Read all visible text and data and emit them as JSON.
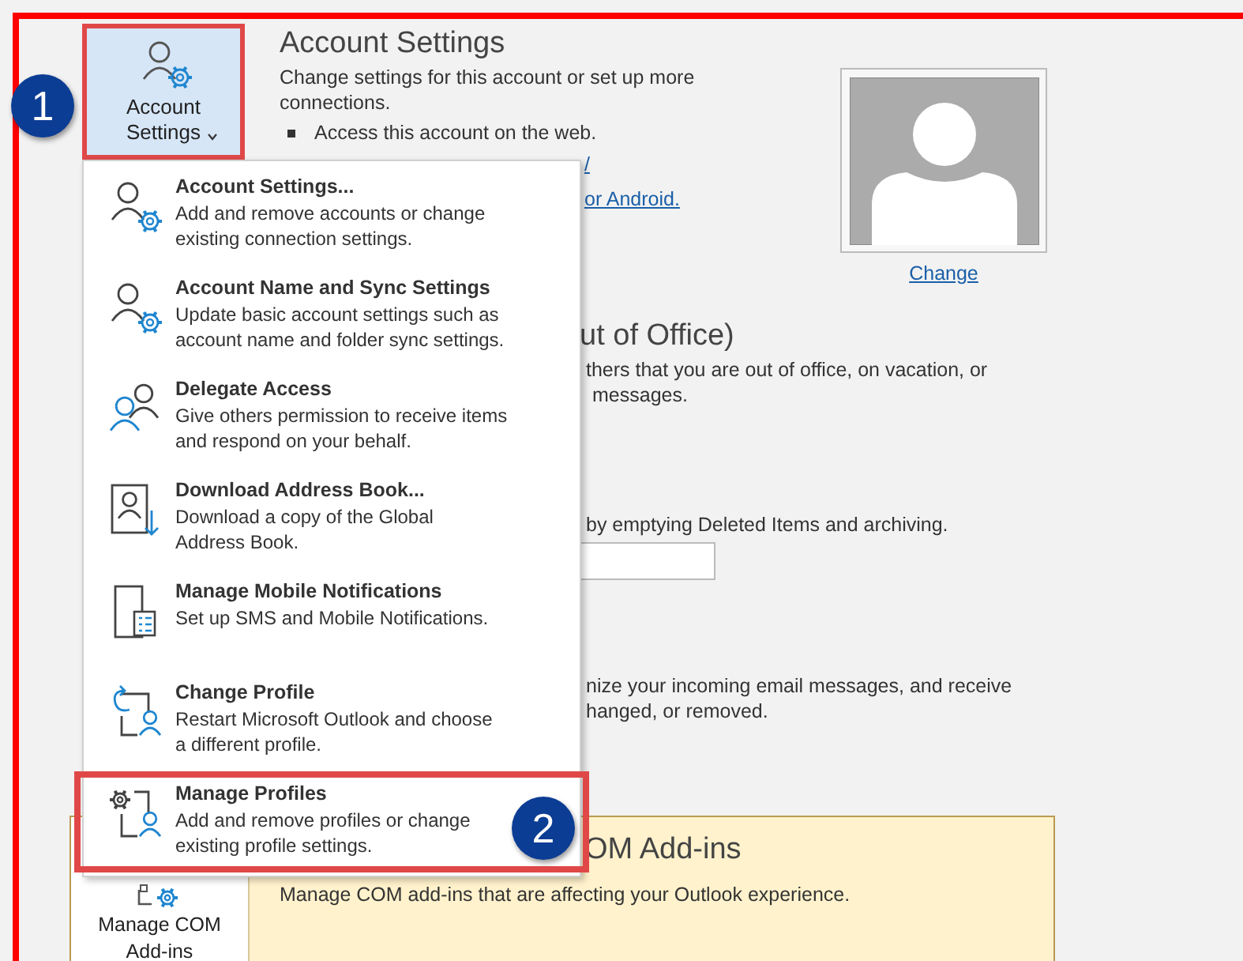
{
  "account_section": {
    "button": {
      "label": "Account Settings",
      "expanded": true,
      "highlighted": true
    },
    "title": "Account Settings",
    "description": "Change settings for this account or set up more connections.",
    "bullets": [
      "Access this account on the web."
    ],
    "links": [
      "/",
      "or Android."
    ],
    "photo_link": "Change"
  },
  "automatic_replies": {
    "title": "ut of Office)",
    "lines": [
      "thers that you are out of office, on vacation, or",
      "messages."
    ]
  },
  "mailbox_settings": {
    "lines": [
      "by emptying Deleted Items and archiving."
    ]
  },
  "rules": {
    "lines": [
      "nize your incoming email messages, and receive",
      "hanged, or removed."
    ]
  },
  "com_addins": {
    "button": "Manage COM Add-ins",
    "title": "OM Add-ins",
    "description": "Manage COM add-ins that are affecting your Outlook experience."
  },
  "menu": {
    "items": [
      {
        "kind": "account-gear",
        "title": "Account Settings...",
        "description": [
          "Add and remove accounts or change",
          "existing connection settings."
        ],
        "highlighted": false
      },
      {
        "kind": "account-gear",
        "title": "Account Name and Sync Settings",
        "description": [
          "Update basic account settings such as",
          "account name and folder sync settings."
        ],
        "highlighted": false
      },
      {
        "kind": "people",
        "title": "Delegate Access",
        "description": [
          "Give others permission to receive items",
          "and respond on your behalf."
        ],
        "highlighted": false
      },
      {
        "kind": "address-book",
        "title": "Download Address Book...",
        "description": [
          "Download a copy of the Global",
          "Address Book."
        ],
        "highlighted": false
      },
      {
        "kind": "phone-list",
        "title": "Manage Mobile Notifications",
        "description": [
          "Set up SMS and Mobile Notifications."
        ],
        "highlighted": false
      },
      {
        "kind": "profile-switch",
        "title": "Change Profile",
        "description": [
          "Restart Microsoft Outlook and choose",
          "a different profile."
        ],
        "highlighted": false
      },
      {
        "kind": "profile-gear",
        "title": "Manage Profiles",
        "description": [
          "Add and remove profiles or change",
          "existing profile settings."
        ],
        "highlighted": true
      }
    ]
  },
  "callouts": [
    "1",
    "2"
  ]
}
